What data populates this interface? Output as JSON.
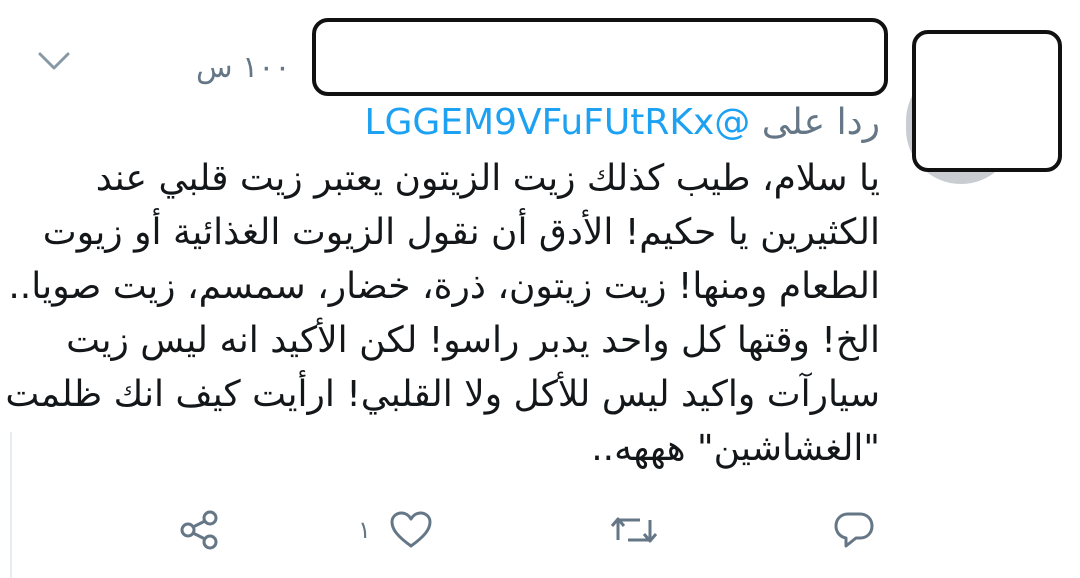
{
  "tweet": {
    "timestamp": "١٠٠ س",
    "reply_prefix": "ردا على",
    "reply_handle": "@LGGEM9VFuFUtRKx",
    "body_lines": [
      "يا سلام، طيب كذلك زيت الزيتون يعتبر زيت قلبي عند",
      "الكثيرين يا حكيم! الأدق أن نقول الزيوت الغذائية أو زيوت",
      "الطعام ومنها! زيت زيتون، ذرة، خضار، سمسم، زيت صويا..",
      "الخ! وقتها كل واحد يدبر راسو! لكن الأكيد انه ليس زيت",
      "سيارآت واكيد ليس للأكل ولا القلبي! ارأيت كيف انك ظلمت",
      "\"الغشاشين\" هههه.."
    ]
  },
  "actions": {
    "share_icon": "share-icon",
    "like_icon": "heart-icon",
    "like_count": "١",
    "retweet_icon": "retweet-icon",
    "reply_icon": "reply-icon"
  },
  "colors": {
    "text": "#14171a",
    "muted": "#657786",
    "link": "#1da1f2"
  }
}
